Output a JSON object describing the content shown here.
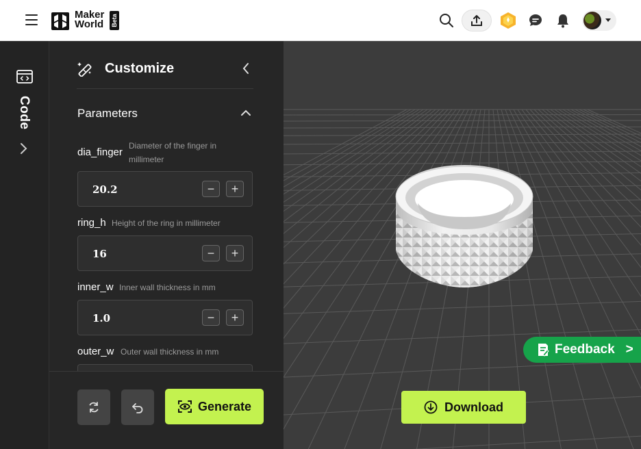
{
  "header": {
    "logo_line1": "Maker",
    "logo_line2": "World",
    "beta_badge": "Beta",
    "icons": [
      "menu-icon",
      "search-icon",
      "upload-icon",
      "points-icon",
      "message-icon",
      "bell-icon",
      "avatar"
    ]
  },
  "rail": {
    "label": "Code",
    "icon": "code-window-icon"
  },
  "panel": {
    "title": "Customize",
    "section_title": "Parameters",
    "params": [
      {
        "name": "dia_finger",
        "desc_line1": "Diameter of the finger in",
        "desc_line2": "millimeter",
        "value": "20.2"
      },
      {
        "name": "ring_h",
        "desc": "Height of the ring in millimeter",
        "value": "16"
      },
      {
        "name": "inner_w",
        "desc": "Inner wall thickness in mm",
        "value": "1.0"
      },
      {
        "name": "outer_w",
        "desc": "Outer wall thickness in mm",
        "value": ""
      }
    ],
    "stepper_minus": "−",
    "stepper_plus": "+",
    "generate_label": "Generate"
  },
  "viewport": {
    "download_label": "Download",
    "feedback_label": "Feedback",
    "feedback_arrow": ">"
  },
  "colors": {
    "accent": "#c3f24f",
    "feedback": "#16a34a",
    "panel_bg": "#262626",
    "viewport_bg": "#3c3c3c"
  }
}
